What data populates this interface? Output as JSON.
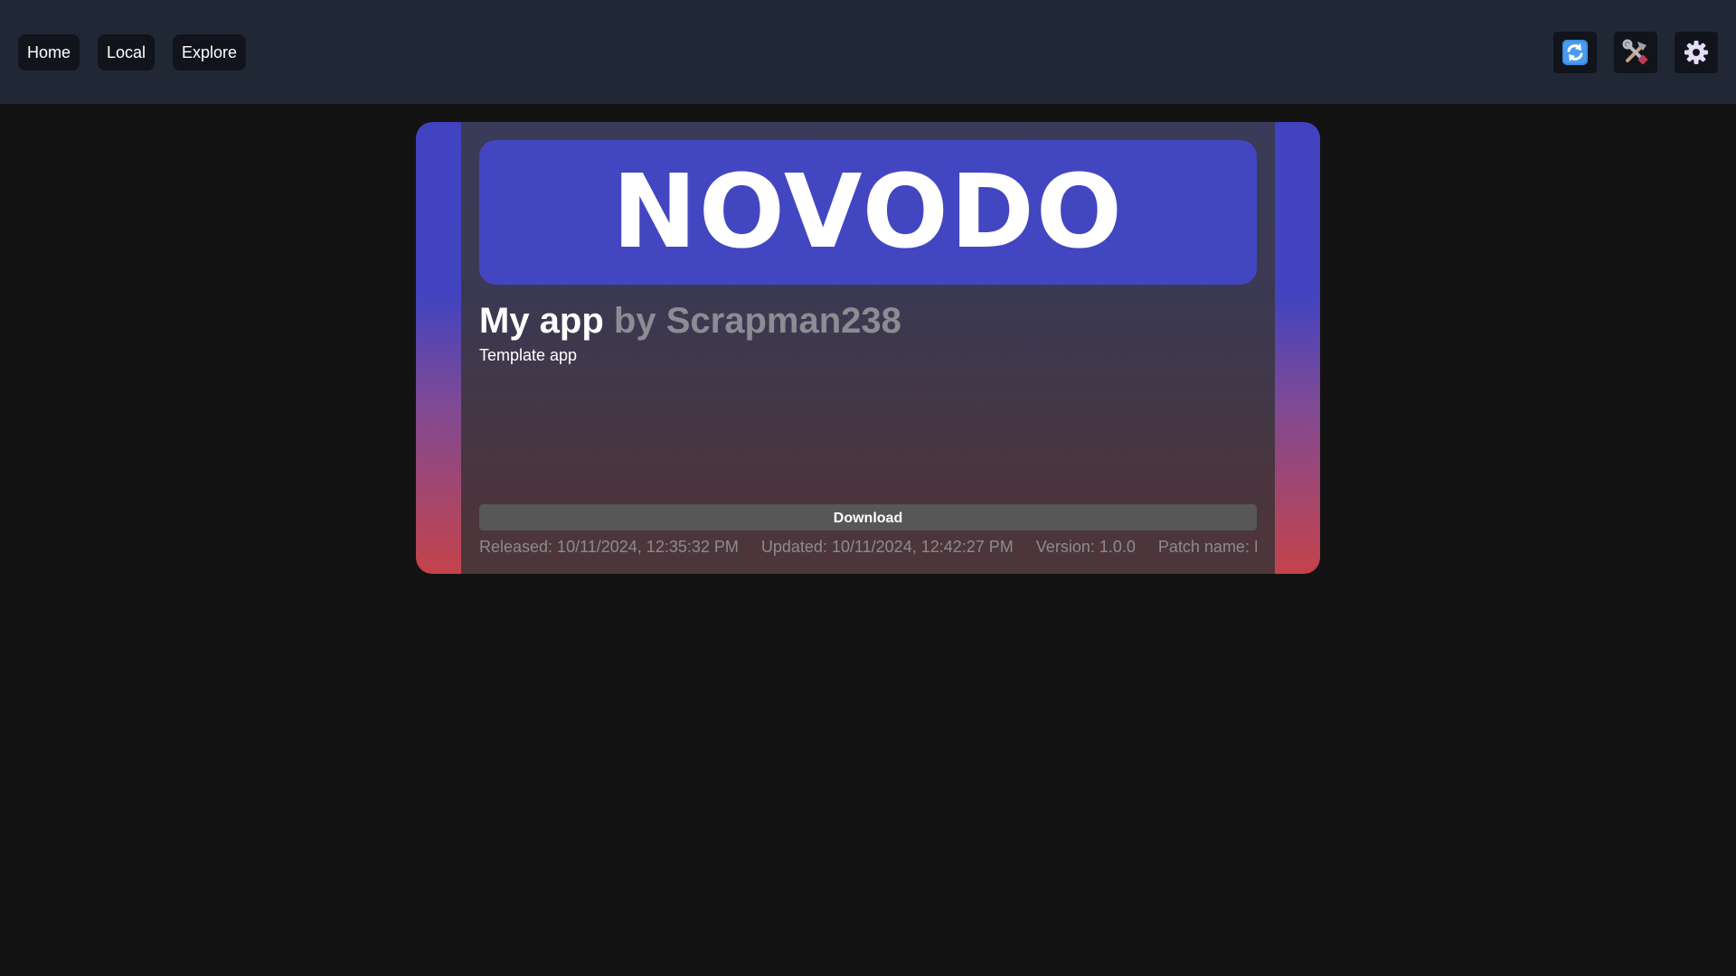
{
  "nav": {
    "home": "Home",
    "local": "Local",
    "explore": "Explore"
  },
  "toolbar": {
    "icons": [
      "refresh-icon",
      "tools-icon",
      "gear-icon"
    ]
  },
  "app": {
    "banner_text": "NOVODO",
    "name": "My app",
    "author": "by Scrapman238",
    "description": "Template app",
    "download_label": "Download",
    "released": "Released: 10/11/2024, 12:35:32 PM",
    "updated": "Updated: 10/11/2024, 12:42:27 PM",
    "version": "Version: 1.0.0",
    "patch_name": "Patch name: Fi"
  },
  "colors": {
    "topbar_bg": "#202836",
    "page_bg": "#121212",
    "banner_bg": "#4346c1",
    "gradient_top": "#4143c0",
    "gradient_bottom": "#c4434a",
    "refresh_icon": "#3d8fe0",
    "gear_icon": "#e7dcf7"
  }
}
